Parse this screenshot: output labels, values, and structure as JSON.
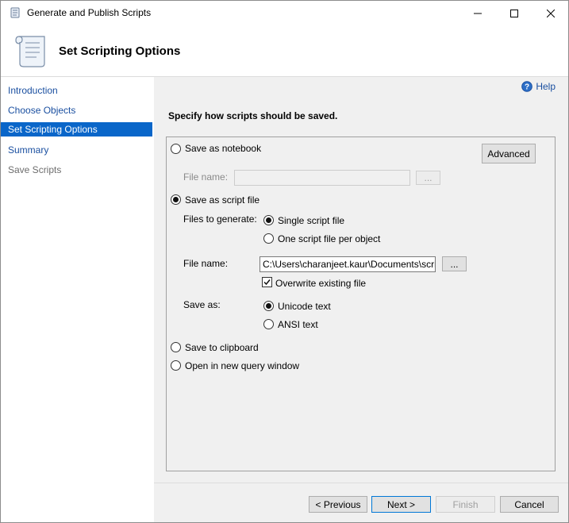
{
  "window": {
    "title": "Generate and Publish Scripts",
    "controls": [
      "minimize-icon",
      "maximize-icon",
      "close-icon"
    ]
  },
  "header": {
    "title": "Set Scripting Options",
    "icon": "scroll-icon"
  },
  "nav": {
    "items": [
      {
        "label": "Introduction",
        "state": "link"
      },
      {
        "label": "Choose Objects",
        "state": "link"
      },
      {
        "label": "Set Scripting Options",
        "state": "active"
      },
      {
        "label": "Summary",
        "state": "link"
      },
      {
        "label": "Save Scripts",
        "state": "disabled"
      }
    ]
  },
  "help": {
    "label": "Help",
    "icon": "help-icon"
  },
  "instruction": "Specify how scripts should be saved.",
  "options": {
    "notebook": {
      "label": "Save as notebook",
      "selected": false
    },
    "advanced_label": "Advanced",
    "notebook_file_label": "File name:",
    "notebook_file_value": "",
    "browse_label": "...",
    "script_file": {
      "label": "Save as script file",
      "selected": true
    },
    "files_to_generate_label": "Files to generate:",
    "single_file": {
      "label": "Single script file",
      "selected": true
    },
    "per_object": {
      "label": "One script file per object",
      "selected": false
    },
    "file_name_label": "File name:",
    "file_name_value": "C:\\Users\\charanjeet.kaur\\Documents\\script.s",
    "overwrite": {
      "label": "Overwrite existing file",
      "checked": true
    },
    "save_as_label": "Save as:",
    "unicode": {
      "label": "Unicode text",
      "selected": true
    },
    "ansi": {
      "label": "ANSI text",
      "selected": false
    },
    "clipboard": {
      "label": "Save to clipboard",
      "selected": false
    },
    "query_window": {
      "label": "Open in new query window",
      "selected": false
    }
  },
  "footer": {
    "previous": "< Previous",
    "next": "Next >",
    "finish": "Finish",
    "cancel": "Cancel"
  },
  "colors": {
    "accent": "#0a66c9",
    "link": "#1a4fa0",
    "pane": "#f0f0f0"
  }
}
